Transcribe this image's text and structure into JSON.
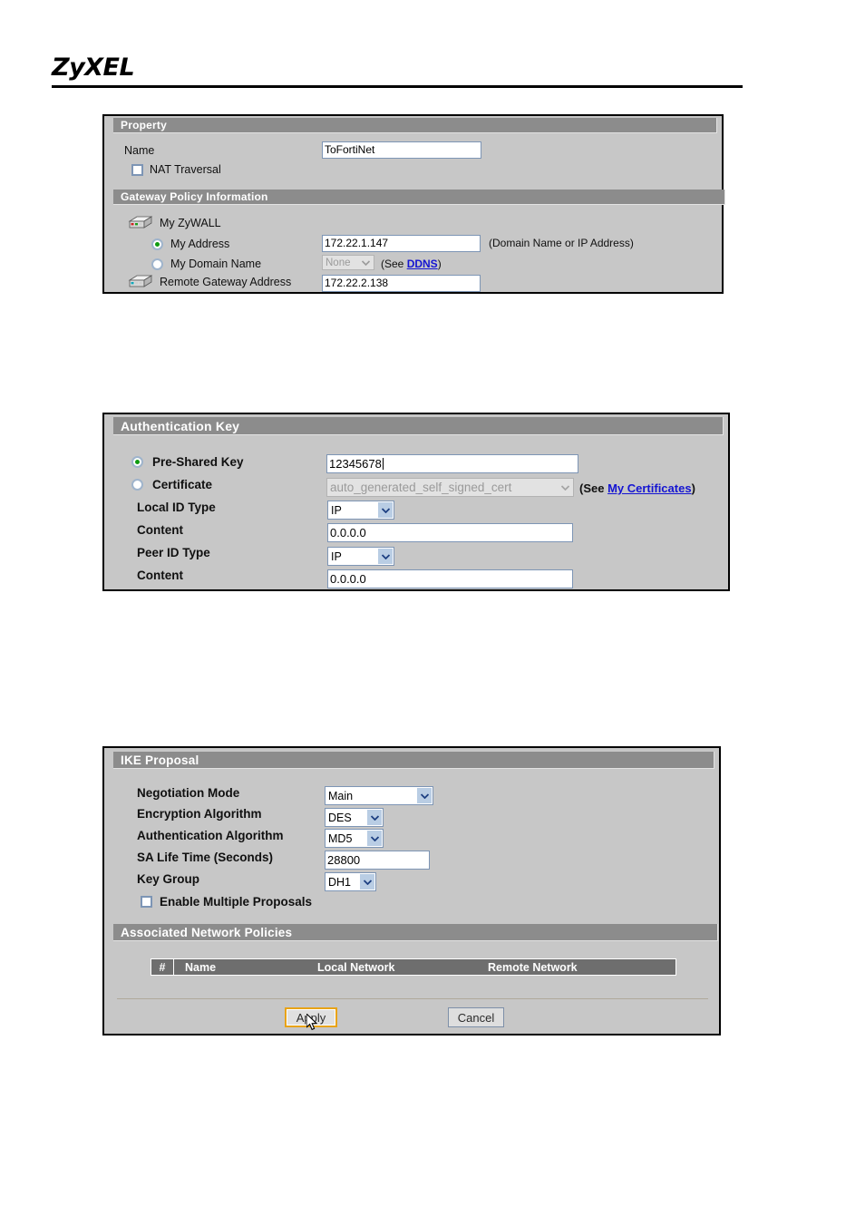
{
  "brand": {
    "logo": "ZyXEL"
  },
  "property_panel": {
    "bar_title": "Property",
    "name_label": "Name",
    "name_value": "ToFortiNet",
    "nat_traversal_label": "NAT Traversal",
    "nat_traversal_checked": false,
    "gateway_bar_title": "Gateway Policy Information",
    "my_zywall_label": "My ZyWALL",
    "my_zywall_icon": "router-icon",
    "my_address_label": "My Address",
    "my_address_selected": true,
    "my_address_value": "172.22.1.147",
    "my_address_hint": "(Domain Name or IP Address)",
    "my_domain_name_label": "My Domain Name",
    "my_domain_name_selected": false,
    "my_domain_name_value": "None",
    "ddns_prefix": "(See ",
    "ddns_link": "DDNS",
    "ddns_suffix": ")",
    "remote_gateway_label": "Remote Gateway Address",
    "remote_gateway_icon": "router-icon",
    "remote_gateway_value": "172.22.2.138"
  },
  "auth_panel": {
    "bar_title": "Authentication Key",
    "pre_shared_key_label": "Pre-Shared Key",
    "pre_shared_key_selected": true,
    "pre_shared_key_value": "12345678",
    "certificate_label": "Certificate",
    "certificate_selected": false,
    "certificate_value": "auto_generated_self_signed_cert",
    "certificate_disabled": true,
    "cert_note_prefix": "(See ",
    "cert_note_link": "My Certificates",
    "cert_note_suffix": ")",
    "local_id_type_label": "Local ID Type",
    "local_id_type_value": "IP",
    "local_content_label": "Content",
    "local_content_value": "0.0.0.0",
    "peer_id_type_label": "Peer ID Type",
    "peer_id_type_value": "IP",
    "peer_content_label": "Content",
    "peer_content_value": "0.0.0.0"
  },
  "ike_panel": {
    "bar_title": "IKE Proposal",
    "negotiation_mode_label": "Negotiation Mode",
    "negotiation_mode_value": "Main",
    "encryption_algorithm_label": "Encryption Algorithm",
    "encryption_algorithm_value": "DES",
    "authentication_algorithm_label": "Authentication Algorithm",
    "authentication_algorithm_value": "MD5",
    "sa_life_time_label": "SA Life Time (Seconds)",
    "sa_life_time_value": "28800",
    "key_group_label": "Key Group",
    "key_group_value": "DH1",
    "enable_multiple_proposals_label": "Enable Multiple Proposals",
    "enable_multiple_proposals_checked": false,
    "associated_bar_title": "Associated Network Policies",
    "table": {
      "columns": [
        "#",
        "Name",
        "Local Network",
        "Remote Network"
      ],
      "rows": []
    },
    "apply_label": "Apply",
    "cancel_label": "Cancel"
  },
  "colors": {
    "panel_bg": "#c7c7c7",
    "bar_bg": "#8c8c8c",
    "table_header_bg": "#6e6e6e",
    "link": "#1414d2",
    "focus_border": "#e8a317",
    "radio_dot": "#0f9b0f"
  }
}
